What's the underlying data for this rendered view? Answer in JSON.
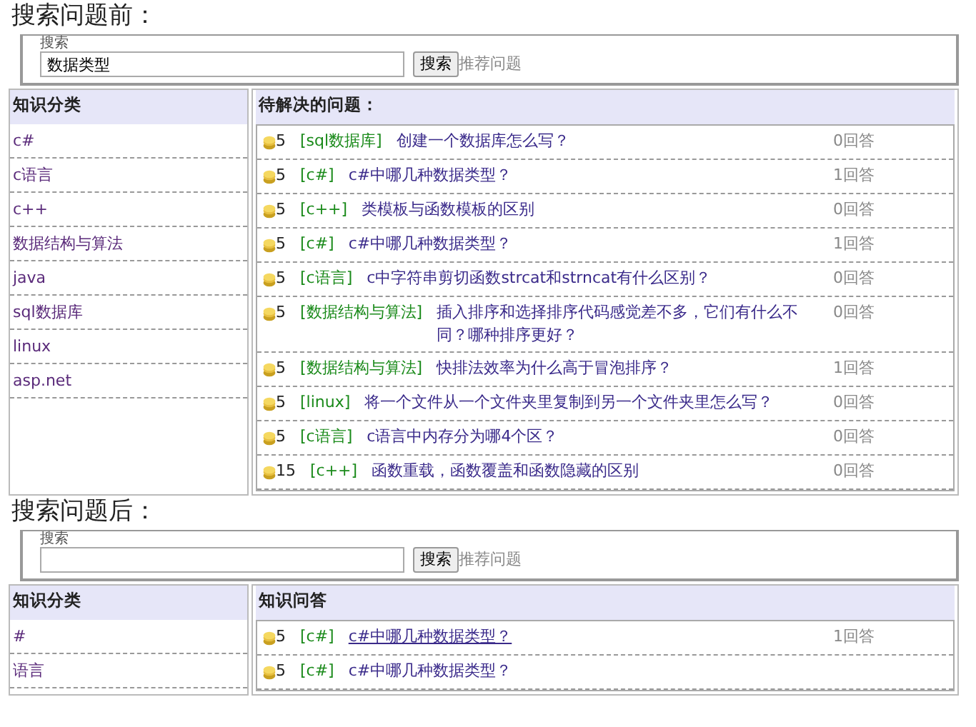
{
  "sections": [
    {
      "caption": "搜索问题前：",
      "search": {
        "legend": "搜索",
        "value": "数据类型",
        "button": "搜索",
        "link": "推荐问题"
      },
      "categories": {
        "title": "知识分类",
        "items": [
          "c#",
          "c语言",
          "c++",
          "数据结构与算法",
          "java",
          "sql数据库",
          "linux",
          "asp.net"
        ]
      },
      "questions": {
        "title": "待解决的问题：",
        "items": [
          {
            "points": "5",
            "tag": "[sql数据库]",
            "title": "创建一个数据库怎么写？",
            "answers": "0回答",
            "underlined": false
          },
          {
            "points": "5",
            "tag": "[c#]",
            "title": "c#中哪几种数据类型？",
            "answers": "1回答",
            "underlined": false
          },
          {
            "points": "5",
            "tag": "[c++]",
            "title": "类模板与函数模板的区别",
            "answers": "0回答",
            "underlined": false
          },
          {
            "points": "5",
            "tag": "[c#]",
            "title": "c#中哪几种数据类型？",
            "answers": "1回答",
            "underlined": false
          },
          {
            "points": "5",
            "tag": "[c语言]",
            "title": "c中字符串剪切函数strcat和strncat有什么区别？",
            "answers": "0回答",
            "underlined": false
          },
          {
            "points": "5",
            "tag": "[数据结构与算法]",
            "title": "插入排序和选择排序代码感觉差不多，它们有什么不同？哪种排序更好？",
            "answers": "0回答",
            "underlined": false
          },
          {
            "points": "5",
            "tag": "[数据结构与算法]",
            "title": "快排法效率为什么高于冒泡排序？",
            "answers": "1回答",
            "underlined": false
          },
          {
            "points": "5",
            "tag": "[linux]",
            "title": "将一个文件从一个文件夹里复制到另一个文件夹里怎么写？",
            "answers": "0回答",
            "underlined": false
          },
          {
            "points": "5",
            "tag": "[c语言]",
            "title": "c语言中内存分为哪4个区？",
            "answers": "0回答",
            "underlined": false
          },
          {
            "points": "15",
            "tag": "[c++]",
            "title": "函数重载，函数覆盖和函数隐藏的区别",
            "answers": "0回答",
            "underlined": false
          }
        ]
      }
    },
    {
      "caption": "搜索问题后：",
      "search": {
        "legend": "搜索",
        "button": "搜索",
        "link": "推荐问题"
      },
      "categories": {
        "title": "知识分类",
        "items": [
          "#",
          "语言"
        ]
      },
      "questions": {
        "title": "知识问答",
        "items": [
          {
            "points": "5",
            "tag": "[c#]",
            "title": "c#中哪几种数据类型？",
            "answers": "1回答",
            "underlined": true
          },
          {
            "points": "5",
            "tag": "[c#]",
            "title": "c#中哪几种数据类型？",
            "underlined": false
          }
        ]
      }
    }
  ]
}
